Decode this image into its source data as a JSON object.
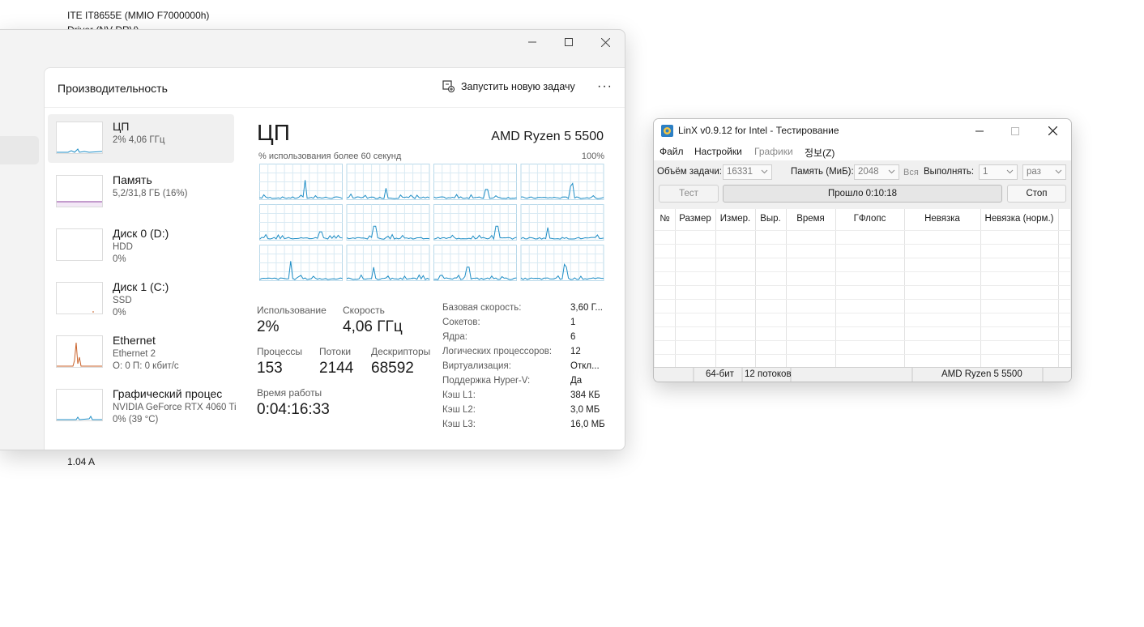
{
  "background": {
    "line1": "ITE IT8655E  (MMIO F7000000h)",
    "line2": "Driver (NV-DRV)",
    "line3": "1.04 A"
  },
  "taskmgr": {
    "header_title": "Производительность",
    "new_task_label": "Запустить новую задачу",
    "more_label": "···",
    "list": [
      {
        "name": "ЦП",
        "sub1": "2%  4,06 ГГц",
        "sub2": ""
      },
      {
        "name": "Память",
        "sub1": "5,2/31,8 ГБ (16%)",
        "sub2": ""
      },
      {
        "name": "Диск 0 (D:)",
        "sub1": "HDD",
        "sub2": "0%"
      },
      {
        "name": "Диск 1 (C:)",
        "sub1": "SSD",
        "sub2": "0%"
      },
      {
        "name": "Ethernet",
        "sub1": "Ethernet 2",
        "sub2": "О: 0  П: 0 кбит/с"
      },
      {
        "name": "Графический процес",
        "sub1": "NVIDIA GeForce RTX 4060 Ti",
        "sub2": "0%  (39 °C)"
      }
    ],
    "cpu": {
      "title": "ЦП",
      "model": "AMD Ryzen 5 5500",
      "graph_label": "% использования более 60 секунд",
      "graph_max": "100%",
      "usage_label": "Использование",
      "usage_value": "2%",
      "speed_label": "Скорость",
      "speed_value": "4,06 ГГц",
      "processes_label": "Процессы",
      "processes_value": "153",
      "threads_label": "Потоки",
      "threads_value": "2144",
      "handles_label": "Дескрипторы",
      "handles_value": "68592",
      "uptime_label": "Время работы",
      "uptime_value": "0:04:16:33",
      "specs": [
        {
          "k": "Базовая скорость:",
          "v": "3,60 Г..."
        },
        {
          "k": "Сокетов:",
          "v": "1"
        },
        {
          "k": "Ядра:",
          "v": "6"
        },
        {
          "k": "Логических процессоров:",
          "v": "12"
        },
        {
          "k": "Виртуализация:",
          "v": "Откл..."
        },
        {
          "k": "Поддержка Hyper-V:",
          "v": "Да"
        },
        {
          "k": "Кэш L1:",
          "v": "384 КБ"
        },
        {
          "k": "Кэш L2:",
          "v": "3,0 МБ"
        },
        {
          "k": "Кэш L3:",
          "v": "16,0 МБ"
        }
      ]
    },
    "colors": {
      "cpu_line": "#1f8ec6",
      "memory_line": "#8b3f9e",
      "ethernet_line": "#c9622a",
      "grid": "#d9eaf3"
    }
  },
  "linx": {
    "title": "LinX v0.9.12 for Intel - Тестирование",
    "menu": {
      "file": "Файл",
      "settings": "Настройки",
      "graphs": "Графики",
      "info": "정보(Z)"
    },
    "size_label": "Объём задачи:",
    "size_value": "16331",
    "memory_label": "Память (МиБ):",
    "memory_value": "2048",
    "all_label": "Вся",
    "run_label": "Выполнять:",
    "run_value": "1",
    "run_unit": "раз",
    "test_button": "Тест",
    "progress_text": "Прошло 0:10:18",
    "stop_button": "Стоп",
    "columns": [
      "№",
      "Размер",
      "Измер.",
      "Выр.",
      "Время",
      "ГФлопс",
      "Невязка",
      "Невязка (норм.)"
    ],
    "status": {
      "bits": "64-бит",
      "threads": "12 потоков",
      "cpu": "AMD Ryzen 5 5500"
    }
  }
}
